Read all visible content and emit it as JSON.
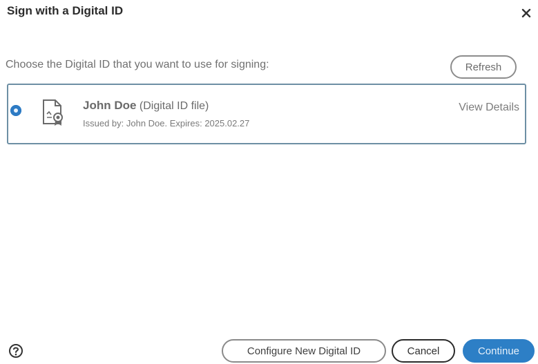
{
  "dialog": {
    "title": "Sign with a Digital ID",
    "close_icon": "close-icon"
  },
  "prompt": "Choose the Digital ID that you want to use for signing:",
  "refresh_label": "Refresh",
  "digital_ids": [
    {
      "selected": true,
      "icon": "certificate-file-icon",
      "name": "John Doe",
      "type": "(Digital ID file)",
      "issued": "Issued by: John Doe. Expires: 2025.02.27",
      "view_details_label": "View Details"
    }
  ],
  "footer": {
    "help_icon": "help-icon",
    "configure_label": "Configure New Digital ID",
    "cancel_label": "Cancel",
    "continue_label": "Continue"
  },
  "colors": {
    "accent": "#2d7fc6",
    "list_border": "#6d8fa4"
  }
}
